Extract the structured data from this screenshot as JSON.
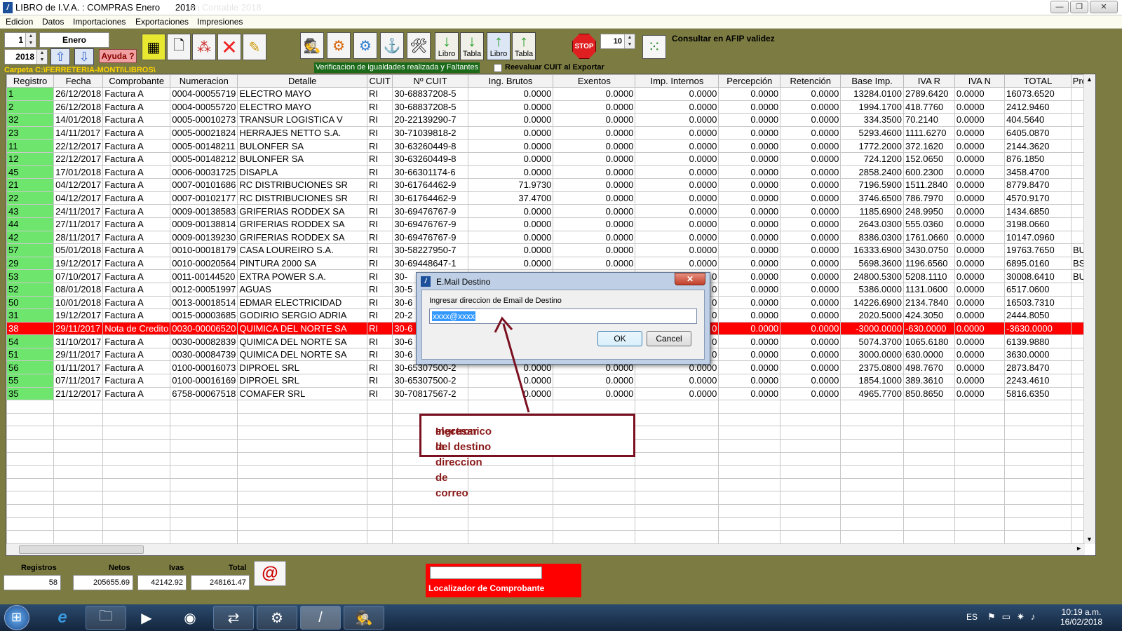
{
  "window": {
    "title": "LIBRO de I.V.A. : COMPRAS Enero",
    "year_label": "2018",
    "ghost_text": "en Contable 2018"
  },
  "menu": [
    "Edicion",
    "Datos",
    "Importaciones",
    "Exportaciones",
    "Impresiones"
  ],
  "toolbar": {
    "month_num": "1",
    "month_name": "Enero",
    "year": "2018",
    "ayuda_label": "Ayuda ?",
    "btn_libro_1": "Libro",
    "btn_tabla_1": "Tabla",
    "btn_libro_2": "Libro",
    "btn_tabla_2": "Tabla",
    "stop_label": "STOP",
    "spin_value": "10",
    "afip_label": "Consultar en AFIP validez",
    "carpeta": "Carpeta C:\\FERRETERIA-MONTI\\LIBROS\\",
    "verificacion": "Verificacion de igualdades realizada y Faltantes",
    "reevaluar": "Reevaluar CUIT al Exportar"
  },
  "columns": [
    "Registro",
    "Fecha",
    "Comprobante",
    "Numeracion",
    "Detalle",
    "CUIT",
    "Nº CUIT",
    "Ing. Brutos",
    "Exentos",
    "Imp. Internos",
    "Percepción",
    "Retención",
    "Base Imp.",
    "IVA R",
    "IVA N",
    "TOTAL",
    "Provi"
  ],
  "rows": [
    [
      "1",
      "26/12/2018",
      "Factura A",
      "0004-00055719",
      "ELECTRO  MAYO",
      "RI",
      "30-68837208-5",
      "0.0000",
      "0.0000",
      "0.0000",
      "0.0000",
      "0.0000",
      "13284.0100",
      "2789.6420",
      "0.0000",
      "16073.6520",
      ""
    ],
    [
      "2",
      "26/12/2018",
      "Factura A",
      "0004-00055720",
      "ELECTRO  MAYO",
      "RI",
      "30-68837208-5",
      "0.0000",
      "0.0000",
      "0.0000",
      "0.0000",
      "0.0000",
      "1994.1700",
      "418.7760",
      "0.0000",
      "2412.9460",
      ""
    ],
    [
      "32",
      "14/01/2018",
      "Factura A",
      "0005-00010273",
      "TRANSUR LOGISTICA  V",
      "RI",
      "20-22139290-7",
      "0.0000",
      "0.0000",
      "0.0000",
      "0.0000",
      "0.0000",
      "334.3500",
      "70.2140",
      "0.0000",
      "404.5640",
      ""
    ],
    [
      "23",
      "14/11/2017",
      "Factura A",
      "0005-00021824",
      "HERRAJES NETTO S.A.",
      "RI",
      "30-71039818-2",
      "0.0000",
      "0.0000",
      "0.0000",
      "0.0000",
      "0.0000",
      "5293.4600",
      "1111.6270",
      "0.0000",
      "6405.0870",
      ""
    ],
    [
      "11",
      "22/12/2017",
      "Factura A",
      "0005-00148211",
      "BULONFER SA",
      "RI",
      "30-63260449-8",
      "0.0000",
      "0.0000",
      "0.0000",
      "0.0000",
      "0.0000",
      "1772.2000",
      "372.1620",
      "0.0000",
      "2144.3620",
      ""
    ],
    [
      "12",
      "22/12/2017",
      "Factura A",
      "0005-00148212",
      "BULONFER SA",
      "RI",
      "30-63260449-8",
      "0.0000",
      "0.0000",
      "0.0000",
      "0.0000",
      "0.0000",
      "724.1200",
      "152.0650",
      "0.0000",
      "876.1850",
      ""
    ],
    [
      "45",
      "17/01/2018",
      "Factura A",
      "0006-00031725",
      "DISAPLA",
      "RI",
      "30-66301174-6",
      "0.0000",
      "0.0000",
      "0.0000",
      "0.0000",
      "0.0000",
      "2858.2400",
      "600.2300",
      "0.0000",
      "3458.4700",
      ""
    ],
    [
      "21",
      "04/12/2017",
      "Factura A",
      "0007-00101686",
      "RC DISTRIBUCIONES SR",
      "RI",
      "30-61764462-9",
      "71.9730",
      "0.0000",
      "0.0000",
      "0.0000",
      "0.0000",
      "7196.5900",
      "1511.2840",
      "0.0000",
      "8779.8470",
      ""
    ],
    [
      "22",
      "04/12/2017",
      "Factura A",
      "0007-00102177",
      "RC DISTRIBUCIONES SR",
      "RI",
      "30-61764462-9",
      "37.4700",
      "0.0000",
      "0.0000",
      "0.0000",
      "0.0000",
      "3746.6500",
      "786.7970",
      "0.0000",
      "4570.9170",
      ""
    ],
    [
      "43",
      "24/11/2017",
      "Factura A",
      "0009-00138583",
      "GRIFERIAS RODDEX SA",
      "RI",
      "30-69476767-9",
      "0.0000",
      "0.0000",
      "0.0000",
      "0.0000",
      "0.0000",
      "1185.6900",
      "248.9950",
      "0.0000",
      "1434.6850",
      ""
    ],
    [
      "44",
      "27/11/2017",
      "Factura A",
      "0009-00138814",
      "GRIFERIAS RODDEX SA",
      "RI",
      "30-69476767-9",
      "0.0000",
      "0.0000",
      "0.0000",
      "0.0000",
      "0.0000",
      "2643.0300",
      "555.0360",
      "0.0000",
      "3198.0660",
      ""
    ],
    [
      "42",
      "28/11/2017",
      "Factura A",
      "0009-00139230",
      "GRIFERIAS RODDEX SA",
      "RI",
      "30-69476767-9",
      "0.0000",
      "0.0000",
      "0.0000",
      "0.0000",
      "0.0000",
      "8386.0300",
      "1761.0660",
      "0.0000",
      "10147.0960",
      ""
    ],
    [
      "57",
      "05/01/2018",
      "Factura A",
      "0010-00018179",
      "CASA LOUREIRO S.A.",
      "RI",
      "30-58227950-7",
      "0.0000",
      "0.0000",
      "0.0000",
      "0.0000",
      "0.0000",
      "16333.6900",
      "3430.0750",
      "0.0000",
      "19763.7650",
      "BUE"
    ],
    [
      "29",
      "19/12/2017",
      "Factura A",
      "0010-00020564",
      "PINTURA 2000 SA",
      "RI",
      "30-69448647-1",
      "0.0000",
      "0.0000",
      "0.0000",
      "0.0000",
      "0.0000",
      "5698.3600",
      "1196.6560",
      "0.0000",
      "6895.0160",
      "BS A"
    ],
    [
      "53",
      "07/10/2017",
      "Factura A",
      "0011-00144520",
      "EXTRA POWER S.A.",
      "RI",
      "30-",
      "",
      "",
      "0",
      "0.0000",
      "0.0000",
      "24800.5300",
      "5208.1110",
      "0.0000",
      "30008.6410",
      "BUE"
    ],
    [
      "52",
      "08/01/2018",
      "Factura A",
      "0012-00051997",
      "AGUAS",
      "RI",
      "30-5",
      "",
      "",
      "0",
      "0.0000",
      "0.0000",
      "5386.0000",
      "1131.0600",
      "0.0000",
      "6517.0600",
      ""
    ],
    [
      "50",
      "10/01/2018",
      "Factura A",
      "0013-00018514",
      "EDMAR ELECTRICIDAD",
      "RI",
      "30-6",
      "",
      "",
      "0",
      "0.0000",
      "0.0000",
      "14226.6900",
      "2134.7840",
      "0.0000",
      "16503.7310",
      ""
    ],
    [
      "31",
      "19/12/2017",
      "Factura A",
      "0015-00003685",
      "GODIRIO SERGIO ADRIA",
      "RI",
      "20-2",
      "",
      "",
      "0",
      "0.0000",
      "0.0000",
      "2020.5000",
      "424.3050",
      "0.0000",
      "2444.8050",
      ""
    ],
    [
      "38",
      "29/11/2017",
      "Nota de Credito",
      "0030-00006520",
      "QUIMICA DEL NORTE SA",
      "RI",
      "30-6",
      "",
      "",
      "0",
      "0.0000",
      "0.0000",
      "-3000.0000",
      "-630.0000",
      "0.0000",
      "-3630.0000",
      ""
    ],
    [
      "54",
      "31/10/2017",
      "Factura A",
      "0030-00082839",
      "QUIMICA DEL NORTE SA",
      "RI",
      "30-6",
      "",
      "",
      "0",
      "0.0000",
      "0.0000",
      "5074.3700",
      "1065.6180",
      "0.0000",
      "6139.9880",
      ""
    ],
    [
      "51",
      "29/11/2017",
      "Factura A",
      "0030-00084739",
      "QUIMICA DEL NORTE SA",
      "RI",
      "30-6",
      "",
      "",
      "0",
      "0.0000",
      "0.0000",
      "3000.0000",
      "630.0000",
      "0.0000",
      "3630.0000",
      ""
    ],
    [
      "56",
      "01/11/2017",
      "Factura A",
      "0100-00016073",
      "DIPROEL SRL",
      "RI",
      "30-65307500-2",
      "0.0000",
      "0.0000",
      "0.0000",
      "0.0000",
      "0.0000",
      "2375.0800",
      "498.7670",
      "0.0000",
      "2873.8470",
      ""
    ],
    [
      "55",
      "07/11/2017",
      "Factura A",
      "0100-00016169",
      "DIPROEL SRL",
      "RI",
      "30-65307500-2",
      "0.0000",
      "0.0000",
      "0.0000",
      "0.0000",
      "0.0000",
      "1854.1000",
      "389.3610",
      "0.0000",
      "2243.4610",
      ""
    ],
    [
      "35",
      "21/12/2017",
      "Factura A",
      "6758-00067518",
      "COMAFER SRL",
      "RI",
      "30-70817567-2",
      "0.0000",
      "0.0000",
      "0.0000",
      "0.0000",
      "0.0000",
      "4965.7700",
      "850.8650",
      "0.0000",
      "5816.6350",
      ""
    ]
  ],
  "selected_row": "38",
  "footer": {
    "registros_label": "Registros",
    "registros_value": "58",
    "netos_label": "Netos",
    "netos_value": "205655.69",
    "ivas_label": "Ivas",
    "ivas_value": "42142.92",
    "total_label": "Total",
    "total_value": "248161.47",
    "localizador_label": "Localizador de Comprobante"
  },
  "dialog": {
    "title": "E.Mail Destino",
    "prompt": "Ingresar direccion de Email de Destino",
    "value": "xxxx@xxxx",
    "ok": "OK",
    "cancel": "Cancel"
  },
  "callout": {
    "line1": "Ingresar la direccion de correo",
    "line2": "electronico del destino"
  },
  "taskbar": {
    "lang": "ES",
    "time": "10:19 a.m.",
    "date": "16/02/2018"
  },
  "colors": {
    "background": "#7c7c42",
    "registro_cell": "#6ee66e",
    "selected_row": "#ff0000",
    "callout_border": "#7a1020"
  }
}
